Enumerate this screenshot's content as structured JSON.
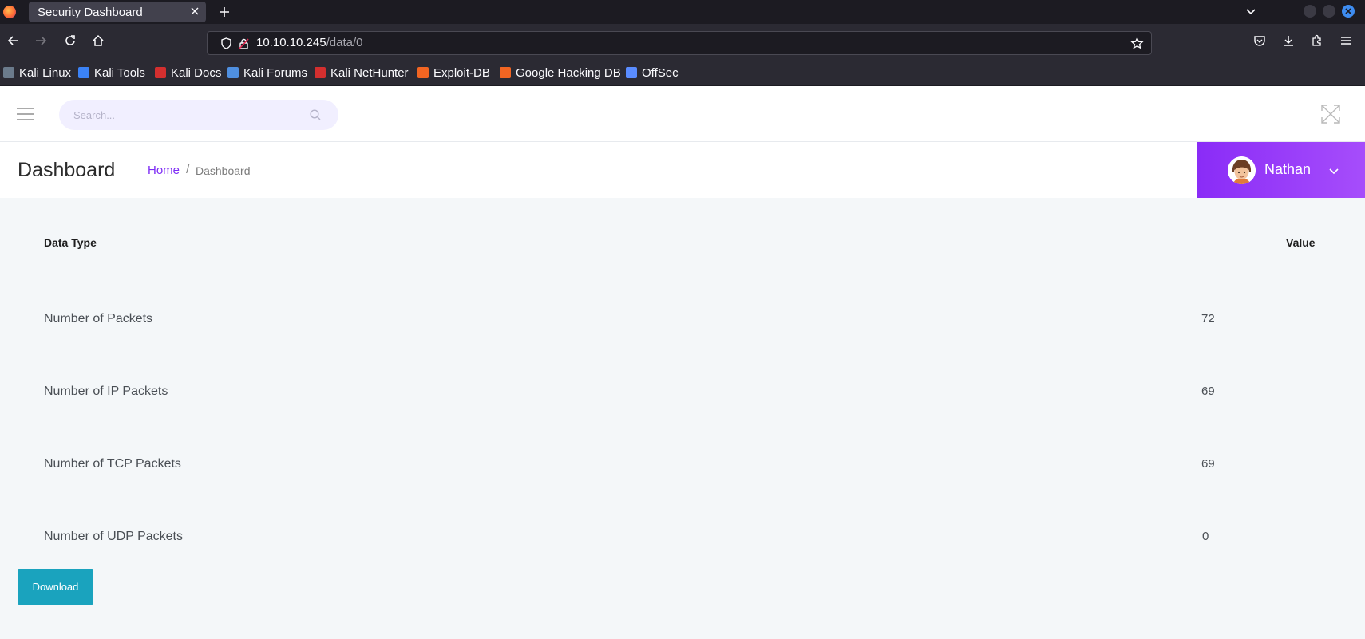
{
  "browser": {
    "tab_title": "Security Dashboard",
    "url_host": "10.10.10.245",
    "url_path": "/data/0",
    "bookmarks": [
      {
        "label": "Kali Linux",
        "color": "#6b7b8c"
      },
      {
        "label": "Kali Tools",
        "color": "#3b82f6"
      },
      {
        "label": "Kali Docs",
        "color": "#d32f2f"
      },
      {
        "label": "Kali Forums",
        "color": "#4f8fe0"
      },
      {
        "label": "Kali NetHunter",
        "color": "#d32f2f"
      },
      {
        "label": "Exploit-DB",
        "color": "#f26522"
      },
      {
        "label": "Google Hacking DB",
        "color": "#f26522"
      },
      {
        "label": "OffSec",
        "color": "#5a8cff"
      }
    ]
  },
  "topbar": {
    "search_placeholder": "Search..."
  },
  "header": {
    "title": "Dashboard",
    "breadcrumb_home": "Home",
    "breadcrumb_sep": "/",
    "breadcrumb_current": "Dashboard"
  },
  "user": {
    "name": "Nathan"
  },
  "table": {
    "headers": {
      "type": "Data Type",
      "value": "Value"
    },
    "rows": [
      {
        "label": "Number of Packets",
        "value": "72"
      },
      {
        "label": "Number of IP Packets",
        "value": "69"
      },
      {
        "label": "Number of TCP Packets",
        "value": "69"
      },
      {
        "label": "Number of UDP Packets",
        "value": "0"
      }
    ]
  },
  "actions": {
    "download_label": "Download"
  },
  "colors": {
    "accent_purple": "#8a2cf7",
    "button_teal": "#1aa3be",
    "page_bg": "#f4f7f9"
  }
}
